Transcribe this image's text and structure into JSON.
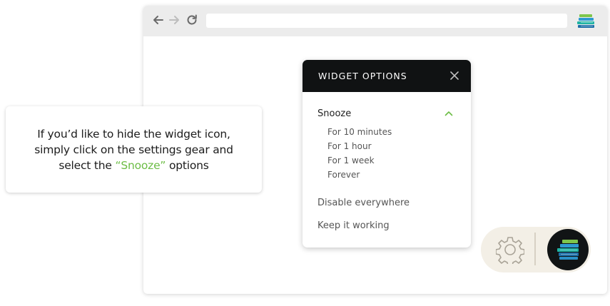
{
  "callout": {
    "line1": "If you’d like to hide the widget icon,",
    "line2": "simply click on the settings gear and",
    "line3_pre": "select the ",
    "line3_highlight": "“Snooze”",
    "line3_post": " options"
  },
  "browser": {
    "back_icon": "arrow-left-icon",
    "forward_icon": "arrow-right-icon",
    "reload_icon": "reload-icon",
    "address_value": "",
    "extension_icon": "books-stack-icon"
  },
  "panel": {
    "title": "WIDGET OPTIONS",
    "close_icon": "close-icon",
    "snooze": {
      "label": "Snooze",
      "expanded_icon": "chevron-up-icon",
      "options": [
        "For 10 minutes",
        "For 1 hour",
        "For 1 week",
        "Forever"
      ]
    },
    "disable_label": "Disable everywhere",
    "keep_label": "Keep it working"
  },
  "widget": {
    "settings_icon": "gear-icon",
    "launcher_icon": "books-stack-icon"
  },
  "colors": {
    "accent_green": "#6cbd45",
    "panel_header": "#101213",
    "pill_bg": "#f3efe6",
    "toolbar_bg": "#ececec"
  }
}
